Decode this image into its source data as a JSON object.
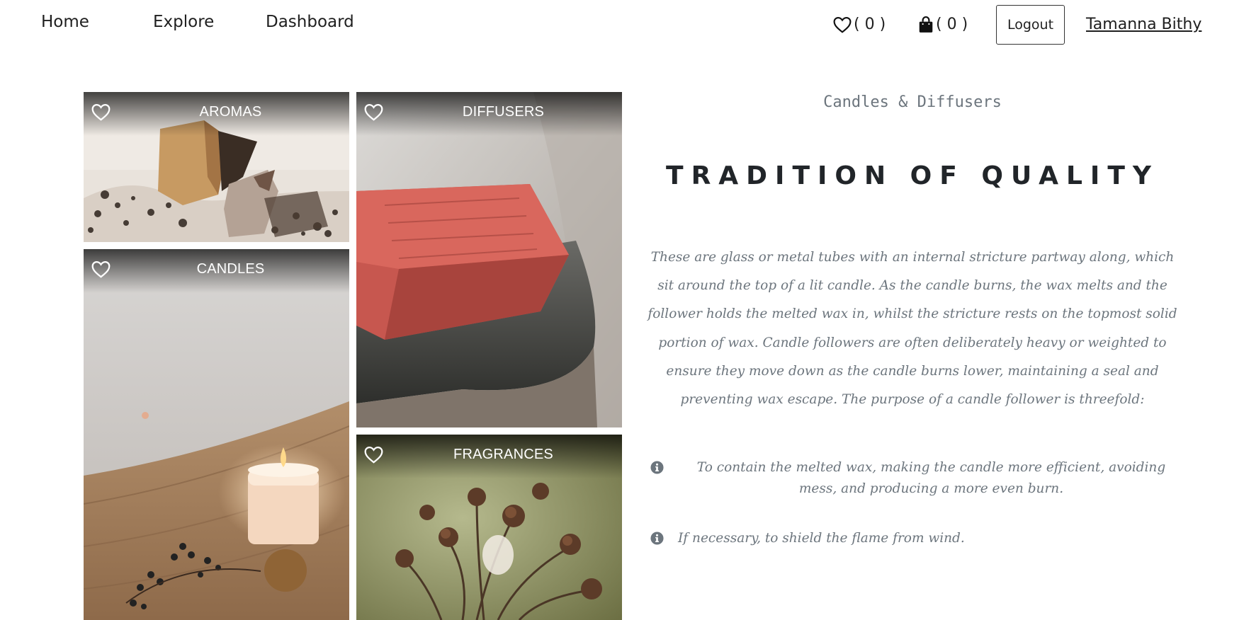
{
  "nav": {
    "links": [
      "Home",
      "Explore",
      "Dashboard"
    ],
    "wishlist_count": "( 0 )",
    "cart_count": "( 0 )",
    "logout_label": "Logout",
    "user_name": "Tamanna Bithy"
  },
  "gallery": {
    "tiles": [
      {
        "label": "AROMAS",
        "icon": "heart-outline-icon"
      },
      {
        "label": "DIFFUSERS",
        "icon": "heart-outline-icon"
      },
      {
        "label": "CANDLES",
        "icon": "heart-outline-icon"
      },
      {
        "label": "FRAGRANCES",
        "icon": "heart-outline-icon"
      }
    ]
  },
  "content": {
    "subtitle": "Candles & Diffusers",
    "heading": "TRADITION OF QUALITY",
    "paragraph": "These are glass or metal tubes with an internal stricture partway along, which sit around the top of a lit candle. As the candle burns, the wax melts and the follower holds the melted wax in, whilst the stricture rests on the topmost solid portion of wax. Candle followers are often deliberately heavy or weighted to ensure they move down as the candle burns lower, maintaining a seal and preventing wax escape. The purpose of a candle follower is threefold:",
    "list": [
      "To contain the melted wax, making the candle more efficient, avoiding mess, and producing a more even burn.",
      "If necessary, to shield the flame from wind."
    ]
  },
  "colors": {
    "text_dark": "#212529",
    "text_muted": "#6c757d",
    "white": "#ffffff"
  }
}
